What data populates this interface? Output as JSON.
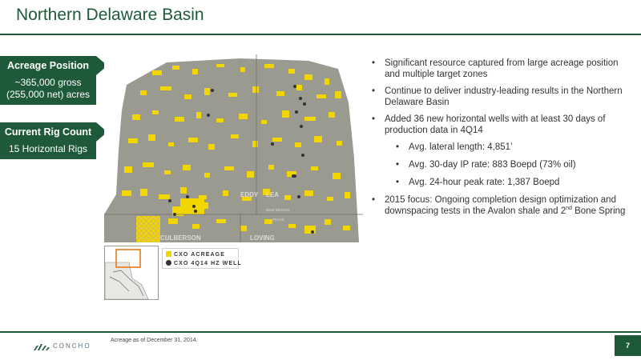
{
  "title": "Northern Delaware Basin",
  "callouts": {
    "acreage": {
      "label": "Acreage Position",
      "line1": "~365,000 gross",
      "line2": "(255,000 net) acres"
    },
    "rig": {
      "label": "Current Rig Count",
      "line1": "15 Horizontal Rigs"
    }
  },
  "map": {
    "labels": {
      "eddy": "EDDY",
      "lea": "LEA",
      "culberson": "CULBERSON",
      "loving": "LOVING",
      "new_mexico": "NEW MEXICO",
      "texas": "TEXAS"
    },
    "colors": {
      "acreage": "#f2d600",
      "well": "#333333",
      "basin": "#9a9a90"
    }
  },
  "legend": {
    "acreage": "CXO ACREAGE",
    "wells": "CXO 4Q14 HZ WELL"
  },
  "bullets": {
    "b1": "Significant resource captured from large acreage position and multiple target zones",
    "b2": "Continue to deliver industry-leading results in the Northern Delaware Basin",
    "b3": "Added 36 new horizontal wells with at least 30 days of production data in 4Q14",
    "sub1": "Avg. lateral length: 4,851’",
    "sub2": "Avg. 30-day IP rate: 883 Boepd (73% oil)",
    "sub3": "Avg. 24-hour peak rate: 1,387 Boepd",
    "b4_a": "2015 focus: Ongoing completion design optimization and downspacing tests in the Avalon shale and 2",
    "b4_sup": "nd",
    "b4_b": " Bone Spring"
  },
  "footnote": "Acreage as of December 31, 2014.",
  "logo_text": "CONCHO",
  "page_number": "7"
}
